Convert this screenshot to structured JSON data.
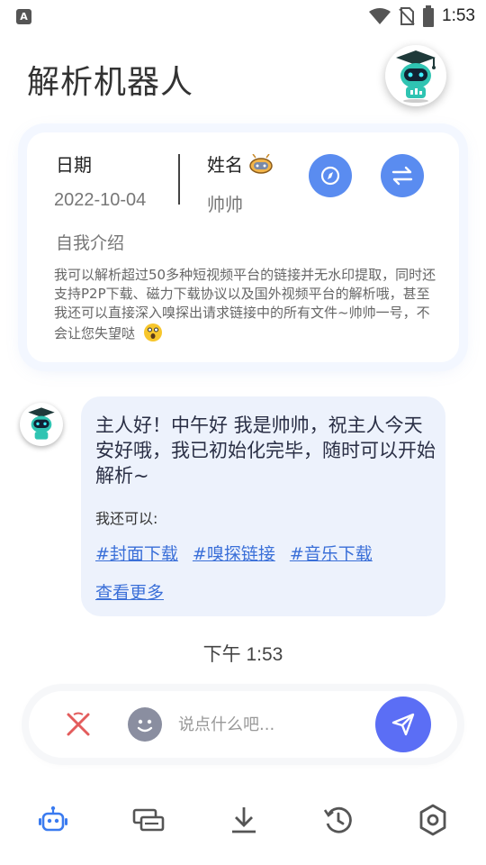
{
  "status_bar": {
    "app_badge": "A",
    "time": "1:53",
    "icons": [
      "wifi-icon",
      "no-sim-icon",
      "battery-icon"
    ]
  },
  "header": {
    "title": "解析机器人",
    "avatar_icon": "robot-graduate-icon"
  },
  "profile": {
    "date_label": "日期",
    "date_value": "2022-10-04",
    "name_label": "姓名",
    "name_value": "帅帅",
    "intro_label": "自我介绍",
    "intro_text": "我可以解析超过50多种短视频平台的链接并无水印提取，同时还支持P2P下载、磁力下载协议以及国外视频平台的解析哦，甚至我还可以直接深入嗅探出请求链接中的所有文件~帅帅一号，不会让您失望哒",
    "buttons": [
      "compass-icon",
      "swap-icon"
    ]
  },
  "chat": {
    "greeting": "主人好！中午好 我是帅帅，祝主人今天安好哦，我已初始化完毕，随时可以开始解析~",
    "can_do": "我还可以:",
    "links": [
      "#封面下载",
      "#嗅探链接",
      "#音乐下载"
    ],
    "more": "查看更多",
    "time": "下午 1:53"
  },
  "input": {
    "placeholder": "说点什么吧..."
  },
  "nav": {
    "items": [
      "robot-icon",
      "cards-icon",
      "download-icon",
      "history-icon",
      "settings-icon"
    ],
    "active_color": "#3a7bf0"
  },
  "colors": {
    "accent": "#5a8cf0",
    "send": "#5b6ef5",
    "link": "#3a6fd8",
    "bubble": "#edf2fc",
    "clear": "#e35c5c"
  }
}
